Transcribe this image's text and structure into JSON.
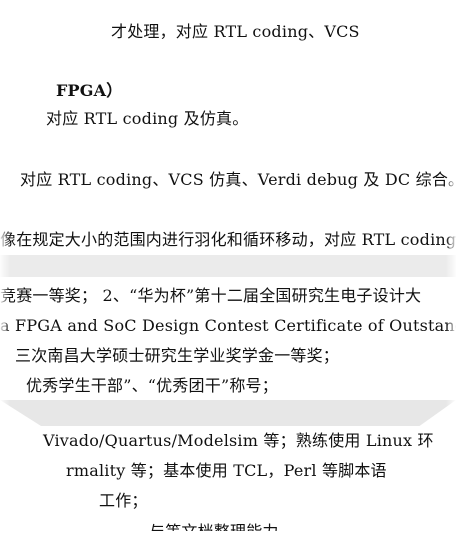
{
  "document": {
    "lines": [
      "才处理，对应 RTL coding、VCS",
      "FPGA）",
      "对应 RTL coding 及仿真。",
      "对应 RTL coding、VCS 仿真、Verdi debug 及 DC 综合。",
      "像在规定大小的范围内进行羽化和循环移动，对应 RTL coding",
      "竞赛一等奖； 2、“华为杯”第十二届全国研究生电子设计大",
      "a FPGA and SoC Design Contest Certificate of Outstanding Ach",
      "三次南昌大学硕士研究生学业奖学金一等奖；",
      "优秀学生干部”、“优秀团干”称号；",
      "Vivado/Quartus/Modelsim 等；熟练使用 Linux 环",
      "rmality 等；基本使用 TCL，Perl 等脚本语",
      "工作；",
      "与等文档整理能力"
    ]
  }
}
